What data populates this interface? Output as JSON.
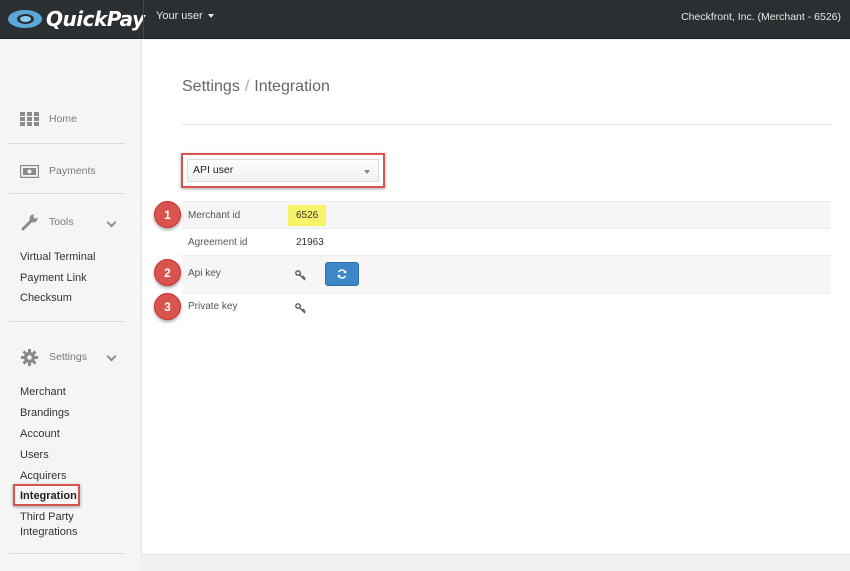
{
  "topbar": {
    "logo_text": "QuickPay",
    "user_menu": "Your user",
    "merchant": "Checkfront, Inc. (Merchant - 6526)"
  },
  "sidebar": {
    "home": {
      "label": "Home",
      "icon": "grid-icon"
    },
    "payments": {
      "label": "Payments",
      "icon": "banknote-icon"
    },
    "tools": {
      "label": "Tools",
      "icon": "wrench-icon",
      "items": [
        "Virtual Terminal",
        "Payment Link",
        "Checksum"
      ]
    },
    "settings": {
      "label": "Settings",
      "icon": "gear-icon",
      "items": [
        "Merchant",
        "Brandings",
        "Account",
        "Users",
        "Acquirers",
        "Integration",
        "Third Party",
        "Integrations"
      ],
      "active": "Integration"
    }
  },
  "main": {
    "breadcrumb": {
      "parent": "Settings",
      "separator": "/",
      "current": "Integration"
    },
    "select": {
      "value": "API user"
    },
    "rows": [
      {
        "label": "Merchant id",
        "value": "6526",
        "badge": "1"
      },
      {
        "label": "Agreement id",
        "value": "21963"
      },
      {
        "label": "Api key",
        "badge": "2",
        "icon": "key-icon",
        "action_icon": "refresh-icon"
      },
      {
        "label": "Private key",
        "badge": "3",
        "icon": "key-icon"
      }
    ]
  },
  "colors": {
    "topbar": "#2b2f32",
    "accent_red": "#d9534f",
    "button_blue": "#3d87c6",
    "highlight_yellow": "#f7f467"
  }
}
